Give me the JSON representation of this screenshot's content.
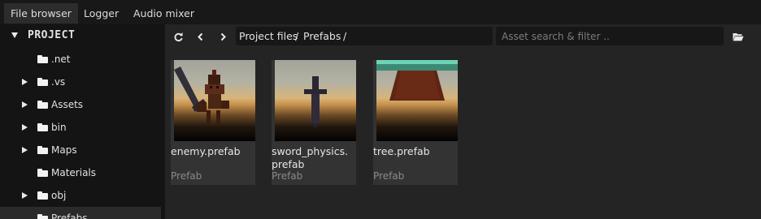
{
  "tabs": [
    {
      "label": "File browser",
      "active": true
    },
    {
      "label": "Logger",
      "active": false
    },
    {
      "label": "Audio mixer",
      "active": false
    }
  ],
  "sidebar": {
    "root": "PROJECT",
    "items": [
      {
        "label": ".net",
        "expander": "none"
      },
      {
        "label": ".vs",
        "expander": "collapsed"
      },
      {
        "label": "Assets",
        "expander": "collapsed"
      },
      {
        "label": "bin",
        "expander": "collapsed"
      },
      {
        "label": "Maps",
        "expander": "collapsed"
      },
      {
        "label": "Materials",
        "expander": "none"
      },
      {
        "label": "obj",
        "expander": "collapsed"
      },
      {
        "label": "Prefabs",
        "expander": "none",
        "selected": true
      }
    ]
  },
  "toolbar": {
    "refresh_icon": "refresh-icon",
    "back_icon": "chevron-left-icon",
    "forward_icon": "chevron-right-icon",
    "open_folder_icon": "folder-open-icon"
  },
  "path": {
    "segments": [
      "Project files",
      "Prefabs"
    ],
    "separator": "/"
  },
  "search": {
    "placeholder": "Asset search & filter ..",
    "value": ""
  },
  "assets": [
    {
      "name": "enemy.prefab",
      "type": "Prefab"
    },
    {
      "name": "sword_physics.prefab",
      "name_line1": "sword_physics.",
      "name_line2": "prefab",
      "type": "Prefab"
    },
    {
      "name": "tree.prefab",
      "type": "Prefab"
    }
  ]
}
